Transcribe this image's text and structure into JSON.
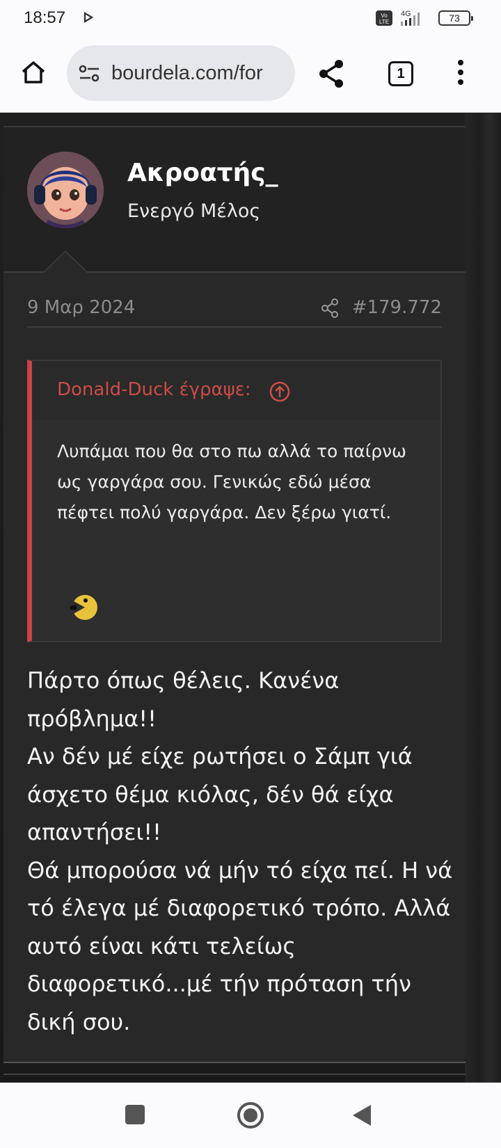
{
  "status_bar": {
    "time": "18:57",
    "battery": "73"
  },
  "browser": {
    "url": "bourdela.com/for",
    "tab_count": "1"
  },
  "post": {
    "username": "Ακροατής_",
    "user_title": "Ενεργό Μέλος",
    "date": "9 Μαρ 2024",
    "post_number": "#179.772",
    "quote": {
      "author_line": "Donald-Duck έγραψε:",
      "text": "Λυπάμαι που θα στο πω αλλά το παίρνω ως γαργάρα σου. Γενικώς εδώ μέσα πέφτει πολύ γαργάρα. Δεν ξέρω γιατί."
    },
    "body_paragraphs": [
      "Πάρτο όπως θέλεις. Κανένα πρόβλημα!!",
      "Αν δέν μέ είχε ρωτήσει ο Σάμπ γιά άσχετο θέμα κιόλας, δέν θά είχα απαντήσει!!",
      "Θά μπορούσα νά μήν τό είχα πεί. Η νά τό έλεγα μέ διαφορετικό τρόπο. Αλλά αυτό είναι κάτι τελείως διαφορετικό...μέ τήν πρόταση τήν δική σου."
    ]
  },
  "icons": {
    "home": "home-icon",
    "site_settings": "tune-icon",
    "share": "share-icon",
    "tabs": "tab-counter-icon",
    "menu": "more-vert-icon",
    "quote_jump": "arrow-up-circle-icon",
    "smiley": "pacman-smiley-icon"
  },
  "colors": {
    "quote_accent": "#c84545",
    "background": "#282828"
  }
}
